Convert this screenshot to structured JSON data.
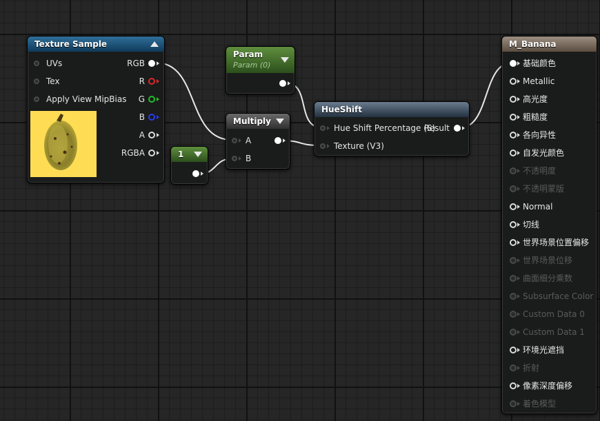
{
  "nodes": {
    "texture_sample": {
      "title": "Texture Sample",
      "inputs": [
        "UVs",
        "Tex",
        "Apply View MipBias"
      ],
      "outputs": [
        "RGB",
        "R",
        "G",
        "B",
        "A",
        "RGBA"
      ]
    },
    "param": {
      "title": "Param",
      "subtitle": "Param (0)"
    },
    "constant": {
      "title": "1"
    },
    "multiply": {
      "title": "Multiply",
      "inputs": [
        "A",
        "B"
      ]
    },
    "hueshift": {
      "title": "HueShift",
      "inputs": [
        "Hue Shift Percentage (S)",
        "Texture (V3)"
      ],
      "output": "Result"
    },
    "material": {
      "title": "M_Banana",
      "inputs": [
        {
          "label": "基础颜色",
          "connected": true,
          "enabled": true
        },
        {
          "label": "Metallic",
          "connected": false,
          "enabled": true
        },
        {
          "label": "高光度",
          "connected": false,
          "enabled": true
        },
        {
          "label": "粗糙度",
          "connected": false,
          "enabled": true
        },
        {
          "label": "各向异性",
          "connected": false,
          "enabled": true
        },
        {
          "label": "自发光颜色",
          "connected": false,
          "enabled": true
        },
        {
          "label": "不透明度",
          "connected": false,
          "enabled": false
        },
        {
          "label": "不透明蒙版",
          "connected": false,
          "enabled": false
        },
        {
          "label": "Normal",
          "connected": false,
          "enabled": true
        },
        {
          "label": "切线",
          "connected": false,
          "enabled": true
        },
        {
          "label": "世界场景位置偏移",
          "connected": false,
          "enabled": true
        },
        {
          "label": "世界场景位移",
          "connected": false,
          "enabled": false
        },
        {
          "label": "曲面细分乘数",
          "connected": false,
          "enabled": false
        },
        {
          "label": "Subsurface Color",
          "connected": false,
          "enabled": false
        },
        {
          "label": "Custom Data 0",
          "connected": false,
          "enabled": false
        },
        {
          "label": "Custom Data 1",
          "connected": false,
          "enabled": false
        },
        {
          "label": "环境光遮挡",
          "connected": false,
          "enabled": true
        },
        {
          "label": "折射",
          "connected": false,
          "enabled": false
        },
        {
          "label": "像素深度偏移",
          "connected": false,
          "enabled": true
        },
        {
          "label": "着色模型",
          "connected": false,
          "enabled": false
        }
      ]
    }
  },
  "colors": {
    "r_pin": "#e0242b",
    "g_pin": "#22c02a",
    "b_pin": "#2a3cf0",
    "wire": "#e8e8e8"
  }
}
